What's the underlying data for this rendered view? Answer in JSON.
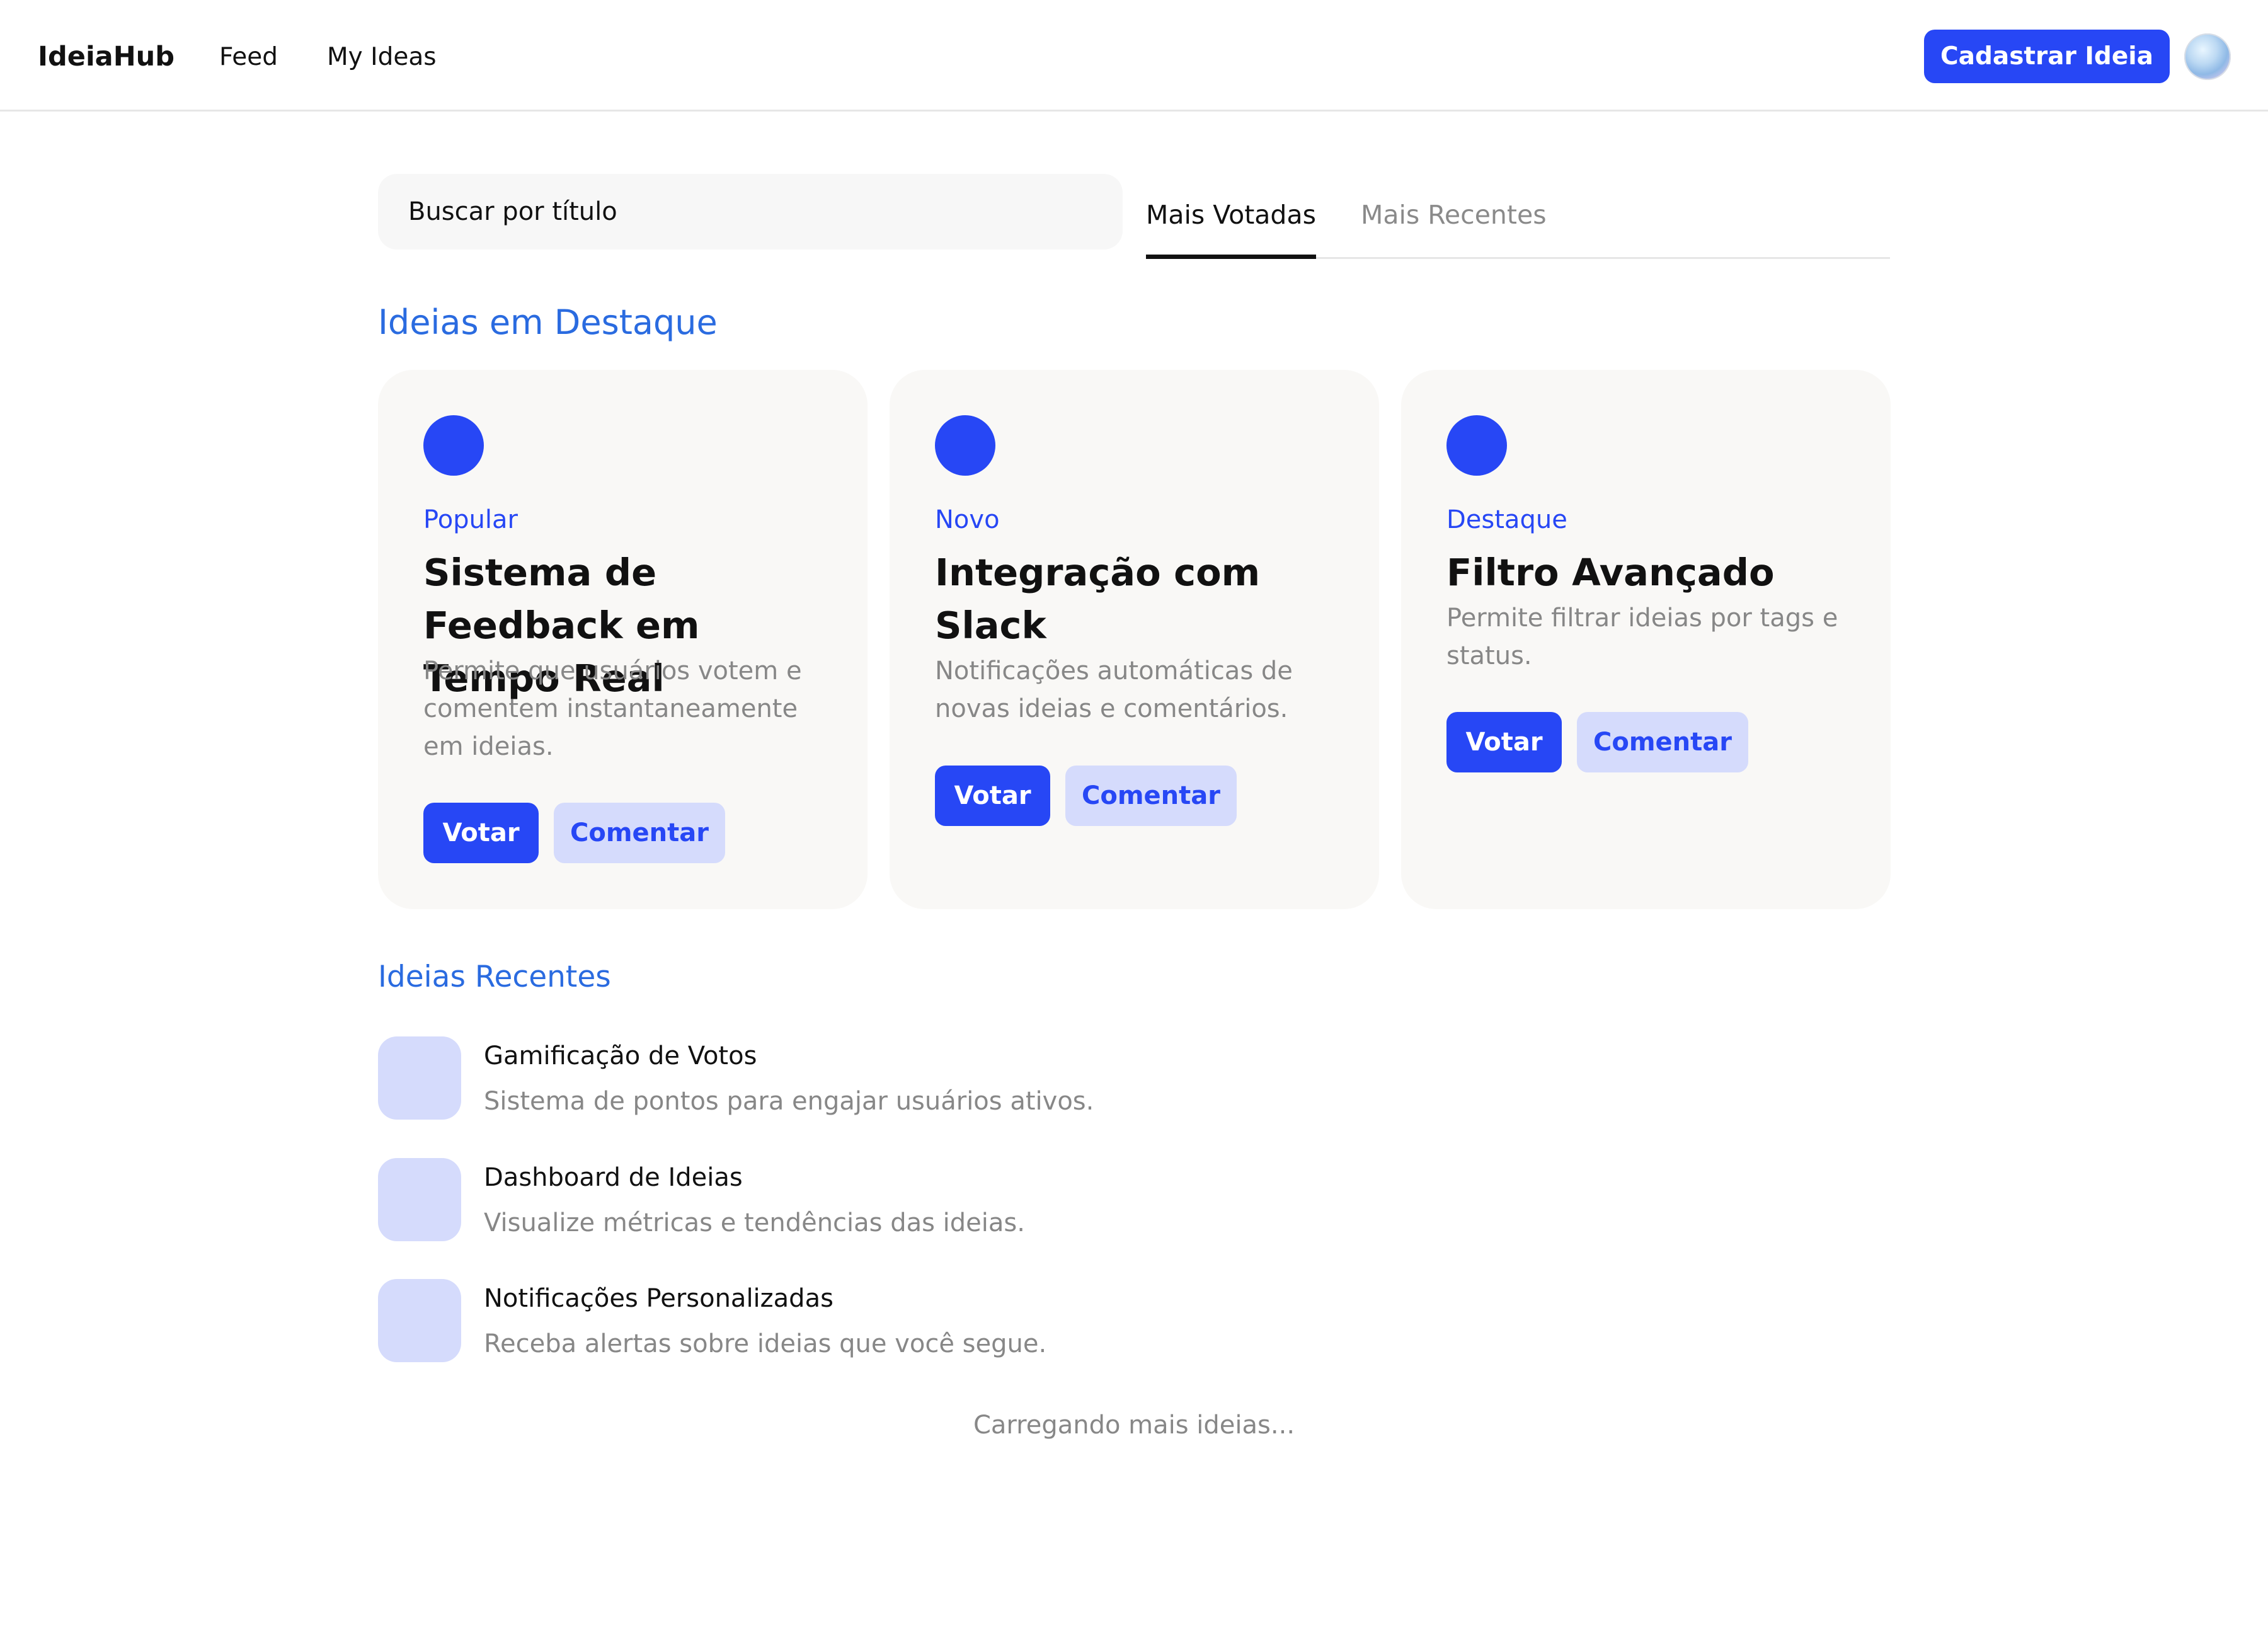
{
  "header": {
    "brand": "IdeiaHub",
    "nav": [
      {
        "label": "Feed"
      },
      {
        "label": "My Ideas"
      }
    ],
    "cta_label": "Cadastrar Ideia",
    "avatar_icon": "user-avatar"
  },
  "search": {
    "placeholder": "Buscar por título"
  },
  "tabs": [
    {
      "label": "Mais Votadas",
      "active": true
    },
    {
      "label": "Mais Recentes",
      "active": false
    }
  ],
  "featured": {
    "title": "Ideias em Destaque",
    "cards": [
      {
        "tag": "Popular",
        "title": "Sistema de Feedback em Tempo Real",
        "description": "Permite que usuários votem e comentem instantaneamente em ideias.",
        "vote_label": "Votar",
        "comment_label": "Comentar"
      },
      {
        "tag": "Novo",
        "title": "Integração com Slack",
        "description": "Notificações automáticas de novas ideias e comentários.",
        "vote_label": "Votar",
        "comment_label": "Comentar"
      },
      {
        "tag": "Destaque",
        "title": "Filtro Avançado",
        "description": "Permite filtrar ideias por tags e status.",
        "vote_label": "Votar",
        "comment_label": "Comentar"
      }
    ]
  },
  "recent": {
    "title": "Ideias Recentes",
    "items": [
      {
        "title": "Gamificação de Votos",
        "description": "Sistema de pontos para engajar usuários ativos."
      },
      {
        "title": "Dashboard de Ideias",
        "description": "Visualize métricas e tendências das ideias."
      },
      {
        "title": "Notificações Personalizadas",
        "description": "Receba alertas sobre ideias que você segue."
      }
    ]
  },
  "loading_text": "Carregando mais ideias...",
  "colors": {
    "accent": "#2747f5",
    "accent_light": "#d5dbfc",
    "section_title": "#2a6be0",
    "muted_text": "#878787",
    "card_bg": "#f9f8f6"
  }
}
